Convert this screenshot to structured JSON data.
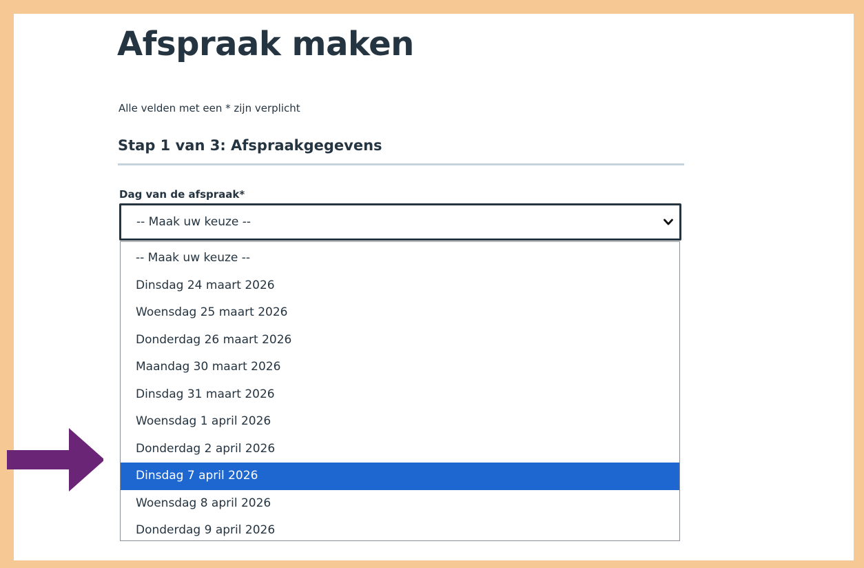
{
  "page": {
    "title": "Afspraak maken",
    "required_note": "Alle velden met een * zijn verplicht",
    "step_heading": "Stap 1 van 3: Afspraakgegevens"
  },
  "form": {
    "day_label": "Dag van de afspraak*",
    "day_select_value": "-- Maak uw keuze --",
    "options": [
      "-- Maak uw keuze --",
      "Dinsdag 24 maart 2026",
      "Woensdag 25 maart 2026",
      "Donderdag 26 maart 2026",
      "Maandag 30 maart 2026",
      "Dinsdag 31 maart 2026",
      "Woensdag 1 april 2026",
      "Donderdag 2 april 2026",
      "Dinsdag 7 april 2026",
      "Woensdag 8 april 2026",
      "Donderdag 9 april 2026"
    ],
    "highlighted_option": "Dinsdag 7 april 2026"
  },
  "colors": {
    "frame": "#f6c893",
    "text": "#253441",
    "highlight": "#1e66d0",
    "arrow": "#6b2576"
  },
  "icons": {
    "select_indicator": "chevron-down-icon",
    "pointer": "arrow-right-icon"
  }
}
